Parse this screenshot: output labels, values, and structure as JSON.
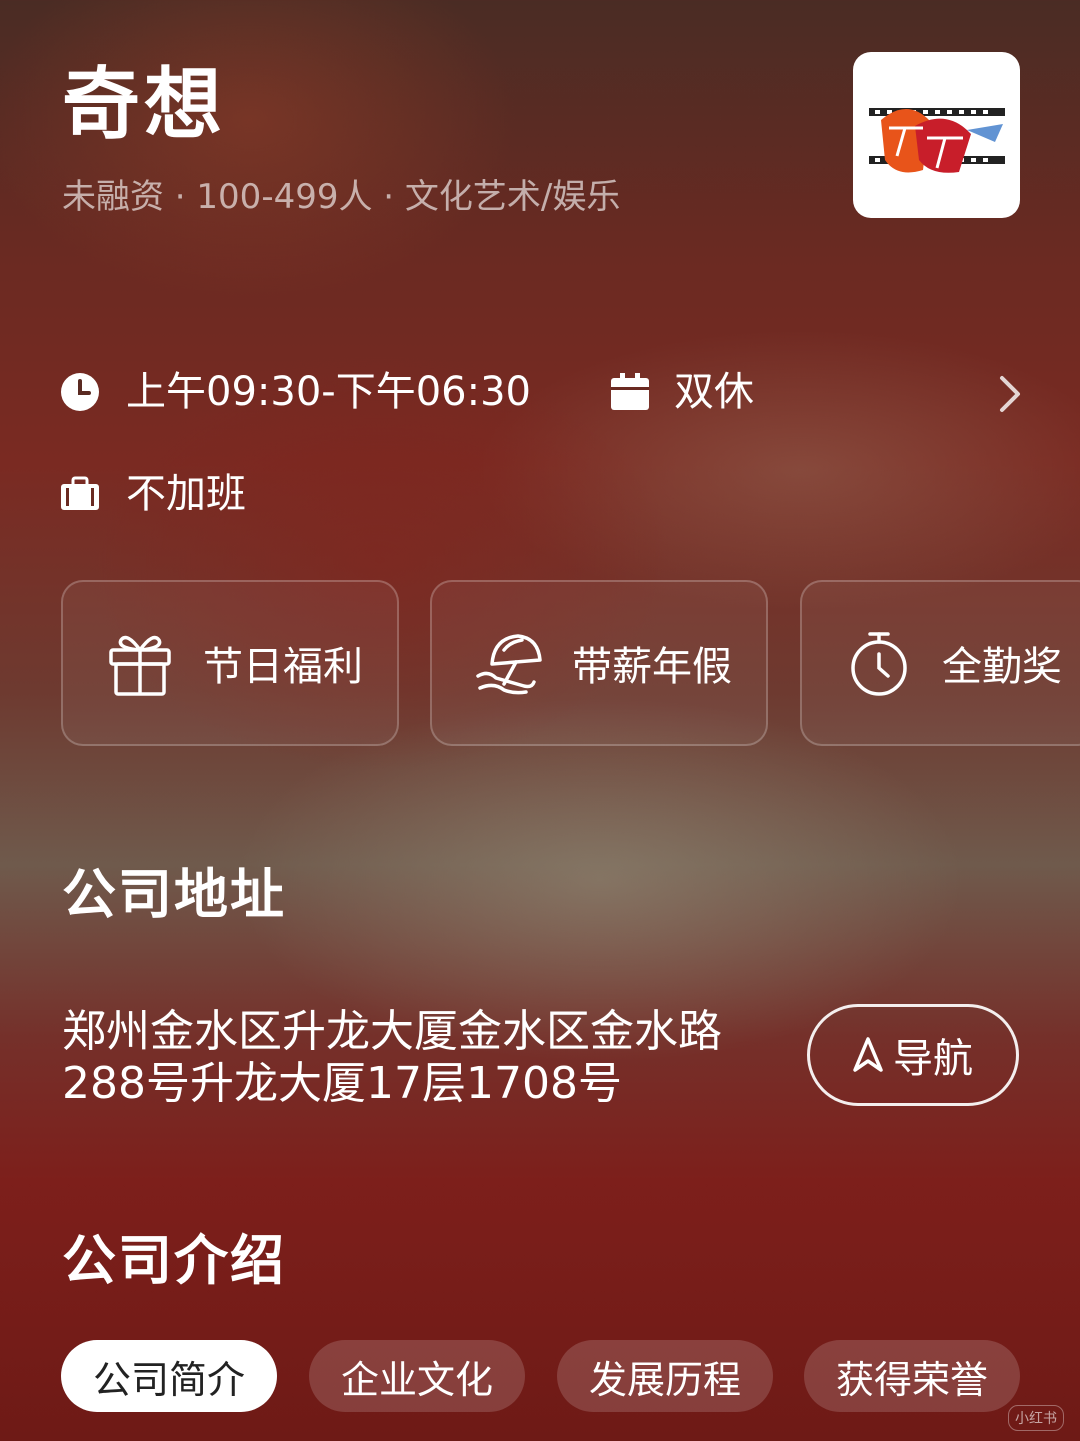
{
  "header": {
    "company_name": "奇想",
    "meta": "未融资 · 100-499人 · 文化艺术/娱乐",
    "logo_icon": "qixiang-logo"
  },
  "work_info": {
    "hours": "上午09:30-下午06:30",
    "hours_icon": "clock-icon",
    "rest": "双休",
    "rest_icon": "calendar-icon",
    "overtime": "不加班",
    "overtime_icon": "briefcase-icon",
    "more_icon": "chevron-right-icon"
  },
  "benefits": [
    {
      "label": "节日福利",
      "icon": "gift-icon"
    },
    {
      "label": "带薪年假",
      "icon": "beach-umbrella-icon"
    },
    {
      "label": "全勤奖",
      "icon": "stopwatch-icon"
    }
  ],
  "address_section": {
    "title": "公司地址",
    "address": "郑州金水区升龙大厦金水区金水路288号升龙大厦17层1708号",
    "nav_label": "导航",
    "nav_icon": "navigation-arrow-icon"
  },
  "intro_section": {
    "title": "公司介绍",
    "tabs": [
      {
        "label": "公司简介",
        "active": true
      },
      {
        "label": "企业文化",
        "active": false
      },
      {
        "label": "发展历程",
        "active": false
      },
      {
        "label": "获得荣誉",
        "active": false
      }
    ]
  },
  "watermark": "小红书"
}
